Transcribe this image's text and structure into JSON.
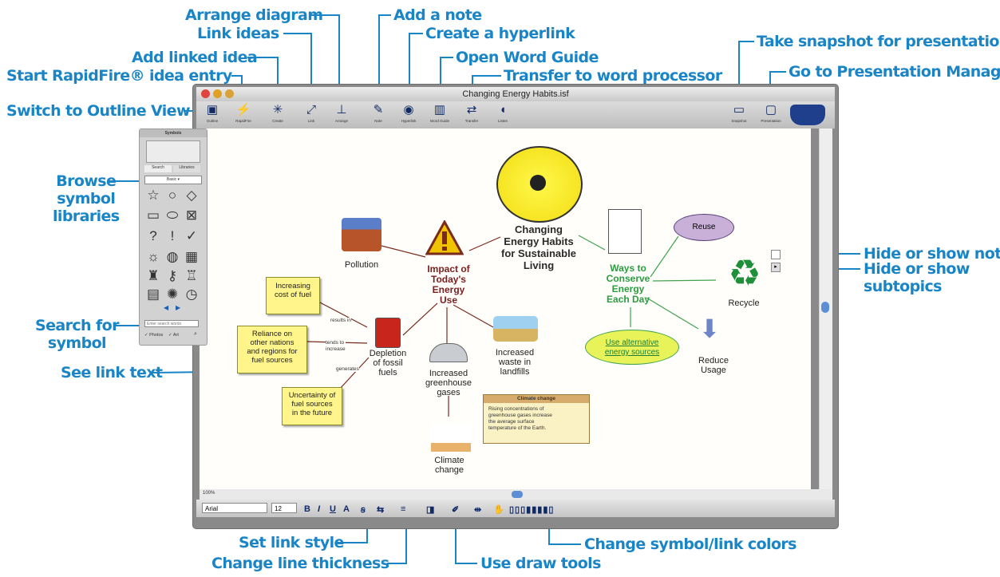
{
  "callouts": {
    "arrange": "Arrange diagram",
    "add_note": "Add a note",
    "link_ideas": "Link ideas",
    "create_hyperlink": "Create a hyperlink",
    "add_linked": "Add linked idea",
    "open_word_guide": "Open Word Guide",
    "rapidfire": "Start RapidFire® idea entry",
    "transfer": "Transfer to word processor",
    "outline_view": "Switch to Outline View",
    "snapshot": "Take snapshot for presentation",
    "presentation_mgr": "Go to Presentation Manager",
    "browse_line1": "Browse",
    "browse_line2": "symbol",
    "browse_line3": "libraries",
    "search_line1": "Search for",
    "search_line2": "symbol",
    "see_link": "See link text",
    "hide_note": "Hide or show note",
    "hide_sub_line1": "Hide or show",
    "hide_sub_line2": "subtopics",
    "set_link_style": "Set link style",
    "line_thickness": "Change line thickness",
    "draw_tools": "Use draw tools",
    "symbol_colors": "Change symbol/link colors"
  },
  "window": {
    "title": "Changing Energy Habits.isf"
  },
  "toolbar": {
    "outline": "Outline",
    "rapidfire": "RapidFire",
    "create": "Create",
    "link": "Link",
    "arrange": "Arrange",
    "note": "Note",
    "hyperlink": "Hyperlink",
    "word_guide": "Word Guide",
    "transfer": "Transfer",
    "listen": "Listen",
    "snapshot": "Snapshot",
    "presentation": "Presentation"
  },
  "symbols_panel": {
    "title": "Symbols",
    "tab_search": "Search",
    "tab_libraries": "Libraries",
    "library": "Basic",
    "search_placeholder": "Enter search words",
    "photos": "Photos",
    "art": "Art"
  },
  "diagram": {
    "main_line1": "Changing",
    "main_line2": "Energy Habits",
    "main_line3": "for Sustainable",
    "main_line4": "Living",
    "impact_line1": "Impact of",
    "impact_line2": "Today's",
    "impact_line3": "Energy",
    "impact_line4": "Use",
    "pollution": "Pollution",
    "depletion_line1": "Depletion",
    "depletion_line2": "of fossil",
    "depletion_line3": "fuels",
    "greenhouse_line1": "Increased",
    "greenhouse_line2": "greenhouse",
    "greenhouse_line3": "gases",
    "waste_line1": "Increased",
    "waste_line2": "waste in",
    "waste_line3": "landfills",
    "climate_line1": "Climate",
    "climate_line2": "change",
    "ways_line1": "Ways to",
    "ways_line2": "Conserve",
    "ways_line3": "Energy",
    "ways_line4": "Each Day",
    "reuse": "Reuse",
    "recycle": "Recycle",
    "reduce_line1": "Reduce",
    "reduce_line2": "Usage",
    "alt_line1": "Use alternative",
    "alt_line2": "energy sources",
    "sticky_cost_line1": "Increasing",
    "sticky_cost_line2": "cost of fuel",
    "sticky_reliance_line1": "Reliance on",
    "sticky_reliance_line2": "other nations",
    "sticky_reliance_line3": "and regions for",
    "sticky_reliance_line4": "fuel sources",
    "sticky_uncertainty_line1": "Uncertainty of",
    "sticky_uncertainty_line2": "fuel sources",
    "sticky_uncertainty_line3": "in the future",
    "link_results": "results in",
    "link_tends_line1": "tends to",
    "link_tends_line2": "increase",
    "link_generates": "generates",
    "note_title": "Climate change",
    "note_line1": "Rising concentrations of",
    "note_line2": "greenhouse gases increase",
    "note_line3": "the average surface",
    "note_line4": "temperature of the Earth."
  },
  "formatbar": {
    "font": "Arial",
    "size": "12",
    "zoom": "100%"
  }
}
